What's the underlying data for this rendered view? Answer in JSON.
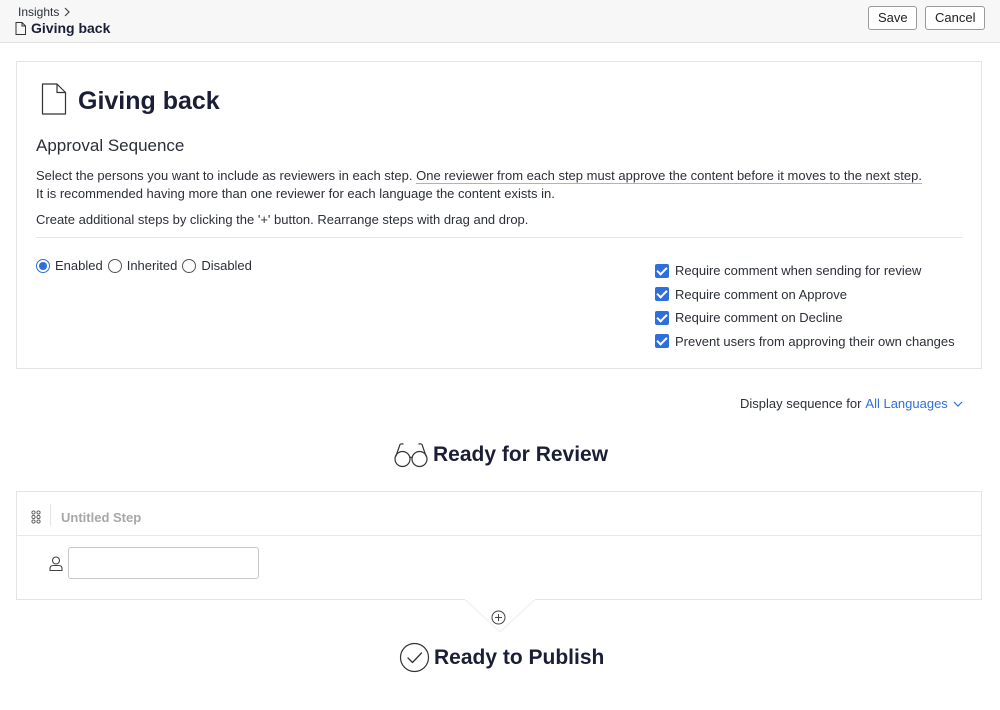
{
  "header": {
    "breadcrumb": "Insights",
    "page_name": "Giving back",
    "save_label": "Save",
    "cancel_label": "Cancel"
  },
  "card": {
    "title": "Giving back",
    "subtitle": "Approval Sequence",
    "desc_part1": "Select the persons you want to include as reviewers in each step. ",
    "desc_highlight": "One reviewer from each step must approve the content before it moves to the next step.",
    "desc_part2": "It is recommended having more than one reviewer for each language the content exists in.",
    "desc_line2": "Create additional steps by clicking the '+' button. Rearrange steps with drag and drop.",
    "radios": [
      {
        "label": "Enabled",
        "selected": true
      },
      {
        "label": "Inherited",
        "selected": false
      },
      {
        "label": "Disabled",
        "selected": false
      }
    ],
    "checkboxes": [
      {
        "label": "Require comment when sending for review",
        "checked": true
      },
      {
        "label": "Require comment on Approve",
        "checked": true
      },
      {
        "label": "Require comment on Decline",
        "checked": true
      },
      {
        "label": "Prevent users from approving their own changes",
        "checked": true
      }
    ]
  },
  "display_sequence": {
    "label": "Display sequence for",
    "value": "All Languages"
  },
  "stages": {
    "review_title": "Ready for Review",
    "publish_title": "Ready to Publish"
  },
  "step": {
    "name": "Untitled Step",
    "reviewer_value": ""
  },
  "colors": {
    "accent": "#2f6fdc",
    "title": "#1a1f36",
    "highlight_underline": "#a9c46c"
  },
  "icons": {
    "page": "document-icon",
    "review": "glasses-icon",
    "publish": "check-circle-icon",
    "drag": "drag-handle-icon",
    "user": "user-icon",
    "add": "plus-circle-icon"
  }
}
